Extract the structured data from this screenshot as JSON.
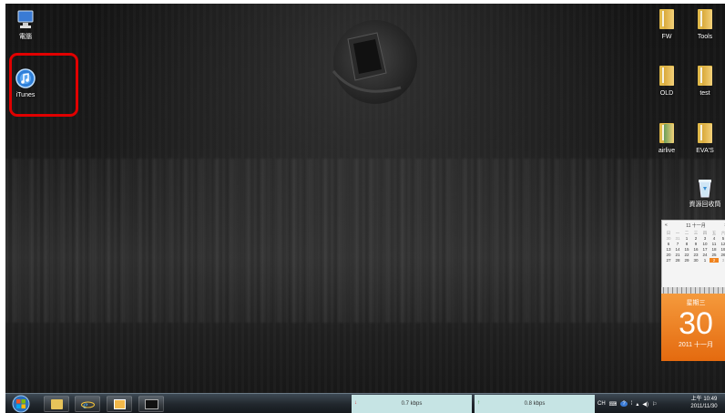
{
  "desktop_icons_left": [
    {
      "label": "電腦",
      "icon": "computer-icon"
    },
    {
      "label": "iTunes",
      "icon": "itunes-icon"
    }
  ],
  "desktop_icons_right": [
    {
      "label": "FW",
      "icon": "folder-icon"
    },
    {
      "label": "Tools",
      "icon": "folder-icon"
    },
    {
      "label": "OLD",
      "icon": "folder-icon"
    },
    {
      "label": "test",
      "icon": "folder-icon"
    },
    {
      "label": "airlive",
      "icon": "folder-icon"
    },
    {
      "label": "EVA'S",
      "icon": "folder-icon"
    },
    {
      "label": "資源回收筒",
      "icon": "recycle-bin-icon"
    }
  ],
  "calendar": {
    "month_header": "11 十一月",
    "prev": "«",
    "next": "»",
    "weekdays": [
      "日",
      "一",
      "二",
      "三",
      "四",
      "五",
      "六"
    ],
    "days": [
      "30",
      "31",
      "1",
      "2",
      "3",
      "4",
      "5",
      "6",
      "7",
      "8",
      "9",
      "10",
      "11",
      "12",
      "13",
      "14",
      "15",
      "16",
      "17",
      "18",
      "19",
      "20",
      "21",
      "22",
      "23",
      "24",
      "25",
      "26",
      "27",
      "28",
      "29",
      "30",
      "1",
      "2",
      "3"
    ],
    "today": "30",
    "big_weekday": "星期三",
    "big_day": "30",
    "big_year_month": "2011 十一月"
  },
  "taskbar": {
    "start": "start-orb-icon",
    "pinned": [
      "explorer-icon",
      "internet-explorer-icon",
      "media-icon",
      "terminal-icon"
    ],
    "meters": [
      {
        "arrow": "↓",
        "value": "0.7 kbps"
      },
      {
        "arrow": "↑",
        "value": "0.8 kbps"
      }
    ],
    "tray": [
      "CH",
      "⌨",
      "?",
      "⁞",
      "▴",
      "◀)",
      "⚐"
    ],
    "clock_time": "上午 10:49",
    "clock_date": "2011/11/30"
  },
  "colors": {
    "highlight": "#e00000",
    "calendar_accent": "#f0831e",
    "meter_bg": "#c6e4e4"
  }
}
